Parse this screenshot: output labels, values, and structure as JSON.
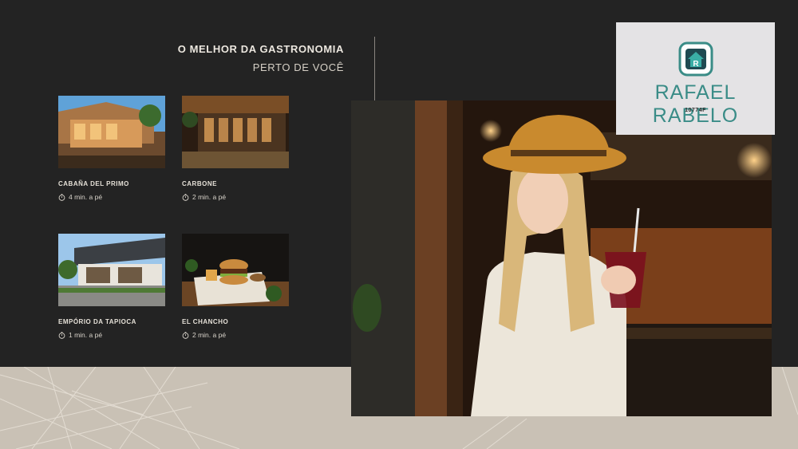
{
  "header": {
    "title": "O MELHOR DA GASTRONOMIA",
    "subtitle": "PERTO DE VOCÊ"
  },
  "restaurants": [
    {
      "name": "CABAÑA DEL PRIMO",
      "time": "4 min. a pé"
    },
    {
      "name": "CARBONE",
      "time": "2 min. a pé"
    },
    {
      "name": "EMPÓRIO DA TAPIOCA",
      "time": "1 min. a pé"
    },
    {
      "name": "EL CHANCHO",
      "time": "2 min. a pé"
    }
  ],
  "logo": {
    "name": "RAFAEL RABELO",
    "registration": "10774F",
    "accent_color": "#3a8c87"
  },
  "colors": {
    "background": "#232323",
    "band": "#c9c1b5"
  }
}
